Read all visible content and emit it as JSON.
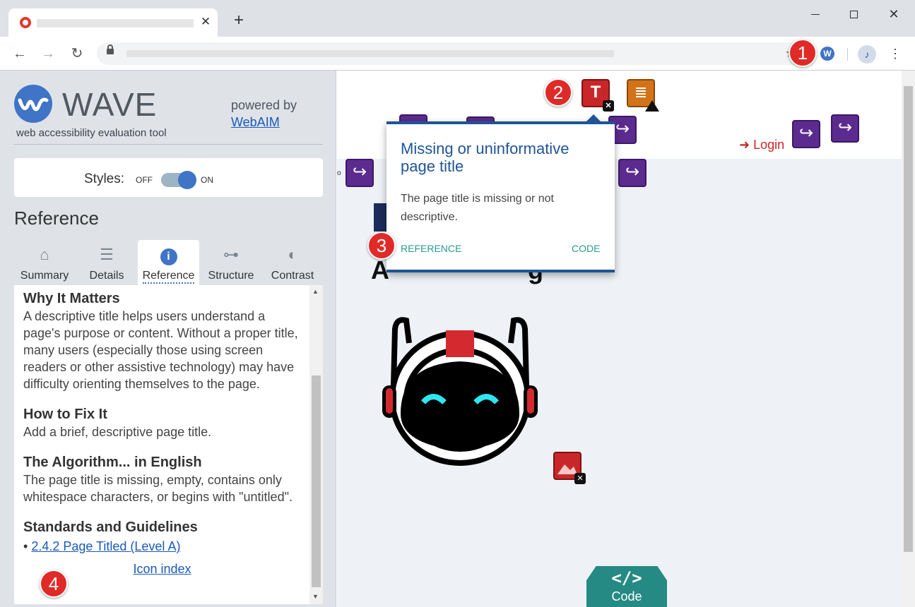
{
  "browser": {
    "tab_close": "✕",
    "new_tab": "+",
    "window_controls": {
      "close": "✕"
    },
    "nav": {
      "back": "←",
      "forward": "→",
      "reload": "↻"
    },
    "star": "★",
    "wave_ext_letter": "W",
    "profile_glyph": "♪",
    "menu": "⋮"
  },
  "sidebar": {
    "wave_title": "WAVE",
    "wave_subtitle": "web accessibility evaluation tool",
    "powered_by": "powered by",
    "powered_link": "WebAIM",
    "styles": {
      "label": "Styles:",
      "off": "OFF",
      "on": "ON",
      "state": "on"
    },
    "reference_heading": "Reference",
    "tabs": [
      {
        "label": "Summary",
        "icon": "home-icon",
        "glyph": "⌂"
      },
      {
        "label": "Details",
        "icon": "list-icon",
        "glyph": "☰"
      },
      {
        "label": "Reference",
        "icon": "info-icon",
        "glyph": "i",
        "active": true
      },
      {
        "label": "Structure",
        "icon": "structure-icon",
        "glyph": "⊶"
      },
      {
        "label": "Contrast",
        "icon": "contrast-icon",
        "glyph": "◐"
      }
    ],
    "content": {
      "why_heading": "Why It Matters",
      "why_text": "A descriptive title helps users understand a page's purpose or content. Without a proper title, many users (especially those using screen readers or other assistive technology) may have difficulty orienting themselves to the page.",
      "fix_heading": "How to Fix It",
      "fix_text": "Add a brief, descriptive page title.",
      "algorithm_heading": "The Algorithm... in English",
      "algorithm_text": "The page title is missing, empty, contains only whitespace characters, or begins with \"untitled\".",
      "standards_heading": "Standards and Guidelines",
      "standard_link": "2.4.2 Page Titled (Level A)",
      "icon_index": "Icon index"
    }
  },
  "page": {
    "login": "Login",
    "partial_text": "o",
    "code_tab": {
      "glyph": "</>",
      "label": "Code"
    },
    "popup": {
      "title": "Missing or uninformative page title",
      "body": "The page title is missing or not descriptive.",
      "reference": "REFERENCE",
      "code": "CODE"
    },
    "error_title_letter": "T",
    "error_badge": "✕",
    "alert_badge": "!",
    "arrow_glyph": "↪"
  },
  "callouts": [
    "1",
    "2",
    "3",
    "4"
  ],
  "colors": {
    "wave_blue": "#3f74c6",
    "error_red": "#c9262a",
    "callout_red": "#e02a27",
    "aria_purple": "#5c2b8f",
    "alert_orange": "#d2731a",
    "popup_navy": "#1f5496",
    "teal": "#2b9a8f"
  }
}
